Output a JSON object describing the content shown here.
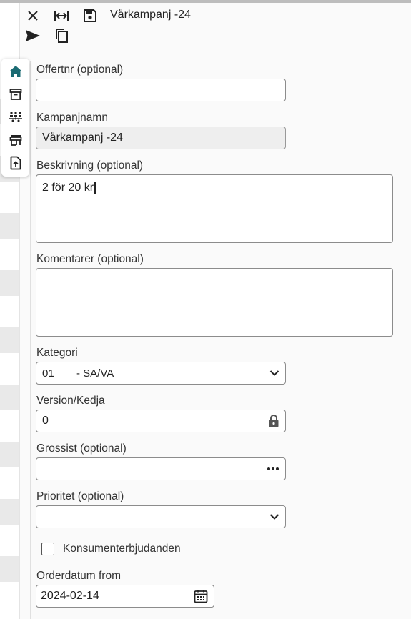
{
  "toolbar": {
    "title": "Vårkampanj -24",
    "icons": [
      "close-icon",
      "fit-width-icon",
      "save-icon",
      "send-icon",
      "copy-icon"
    ]
  },
  "nav": {
    "icons": [
      "home-icon",
      "archive-icon",
      "hierarchy-icon",
      "store-icon",
      "upload-icon"
    ],
    "active_color": "#1b6b73"
  },
  "form": {
    "offertnr": {
      "label": "Offertnr (optional)",
      "value": ""
    },
    "kampanjnamn": {
      "label": "Kampanjnamn",
      "value": "Vårkampanj -24"
    },
    "beskrivning": {
      "label": "Beskrivning (optional)",
      "value": "2 för 20 kr"
    },
    "komentarer": {
      "label": "Komentarer (optional)",
      "value": ""
    },
    "kategori": {
      "label": "Kategori",
      "code": "01",
      "name": "- SA/VA"
    },
    "version": {
      "label": "Version/Kedja",
      "value": "0"
    },
    "grossist": {
      "label": "Grossist (optional)",
      "value": ""
    },
    "prioritet": {
      "label": "Prioritet (optional)",
      "value": ""
    },
    "konsument": {
      "label": "Konsumenterbjudanden",
      "checked": false
    },
    "orderdatum": {
      "label": "Orderdatum from",
      "value": "2024-02-14"
    }
  }
}
